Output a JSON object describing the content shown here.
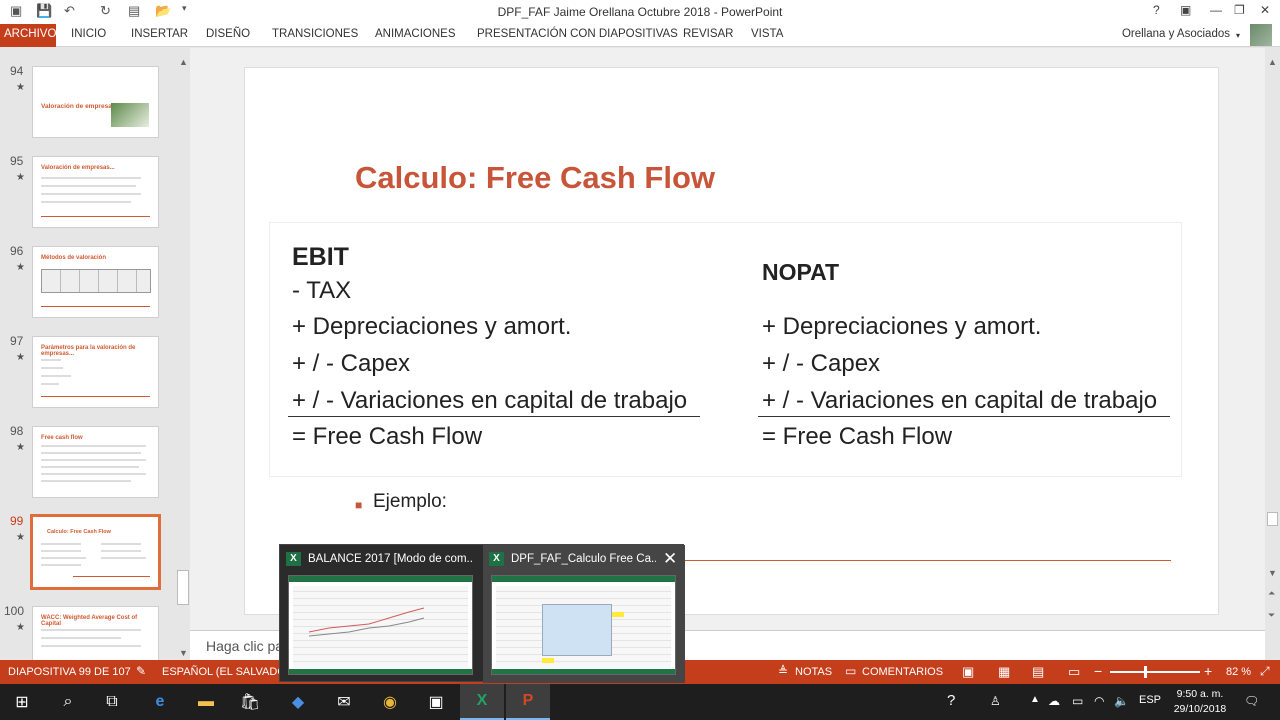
{
  "window": {
    "title": "DPF_FAF Jaime Orellana Octubre 2018 - PowerPoint"
  },
  "ribbon": {
    "tabs": [
      "ARCHIVO",
      "INICIO",
      "INSERTAR",
      "DISEÑO",
      "TRANSICIONES",
      "ANIMACIONES",
      "PRESENTACIÓN CON DIAPOSITIVAS",
      "REVISAR",
      "VISTA"
    ],
    "user": "Orellana y Asociados"
  },
  "thumbnails": [
    {
      "num": "94",
      "title": "Valoración de empresas"
    },
    {
      "num": "95",
      "title": "Valoración de empresas..."
    },
    {
      "num": "96",
      "title": "Métodos de valoración"
    },
    {
      "num": "97",
      "title": "Parámetros para la valoración de empresas..."
    },
    {
      "num": "98",
      "title": "Free cash flow"
    },
    {
      "num": "99",
      "title": "Calculo: Free Cash Flow"
    },
    {
      "num": "100",
      "title": "WACC: Weighted Average Cost of Capital"
    }
  ],
  "slide": {
    "title": "Calculo: Free Cash Flow",
    "left": [
      "EBIT",
      " - TAX",
      " + Depreciaciones y amort.",
      " + / - Capex",
      " + / - Variaciones en capital de trabajo",
      " = Free Cash Flow"
    ],
    "right": [
      "NOPAT",
      " + Depreciaciones y amort.",
      " + / - Capex",
      " + / - Variaciones en capital de trabajo",
      " = Free Cash Flow"
    ],
    "bullet": "Ejemplo:"
  },
  "notes": {
    "placeholder": "Haga clic pa"
  },
  "statusbar": {
    "slide_info": "DIAPOSITIVA 99 DE 107",
    "language": "ESPAÑOL (EL SALVADOR)",
    "notes": "NOTAS",
    "comments": "COMENTARIOS",
    "zoom": "82 %",
    "zoom_level": 0.5
  },
  "previews": [
    {
      "title": "BALANCE 2017  [Modo de com..."
    },
    {
      "title": "DPF_FAF_Calculo Free Ca..."
    }
  ],
  "taskbar": {
    "lang": "ESP",
    "time": "9:50 a. m.",
    "date": "29/10/2018"
  }
}
